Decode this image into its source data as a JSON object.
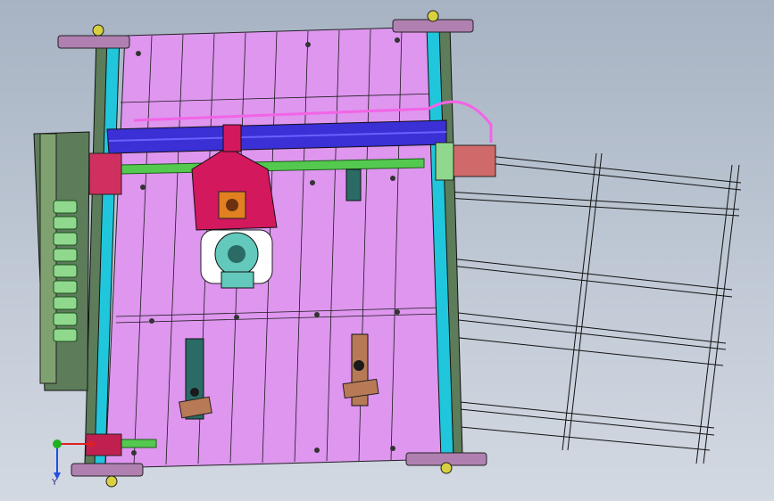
{
  "viewport": {
    "background_top": "#a7b3c3",
    "background_bottom": "#d3d9e2"
  },
  "model": {
    "colors": {
      "frame_plate": "#de96ef",
      "panel_line": "#1c1c1c",
      "gantry_beam": "#3b2fd6",
      "shaft": "#54c94f",
      "motor_body": "#d06a6a",
      "carriage": "#d3185e",
      "fan_housing": "#63c9bc",
      "rail": "#20c6dc",
      "belt_pink": "#f264e6",
      "clamp": "#b87a56",
      "bracket": "#5c7c5a",
      "spool_body": "#8fd88e"
    },
    "parts": [
      "base-plate",
      "left-rail",
      "right-rail",
      "gantry-beam",
      "y-shaft",
      "carriage",
      "stepper-motor",
      "fan-assembly",
      "side-motor",
      "spool-holder",
      "cable-chain",
      "clamp-left",
      "clamp-right",
      "wireframe-sheet"
    ]
  },
  "triad": {
    "y_label": "Y",
    "x_color": "#e02020",
    "y_color": "#2050e0",
    "z_color": "#20b020"
  }
}
